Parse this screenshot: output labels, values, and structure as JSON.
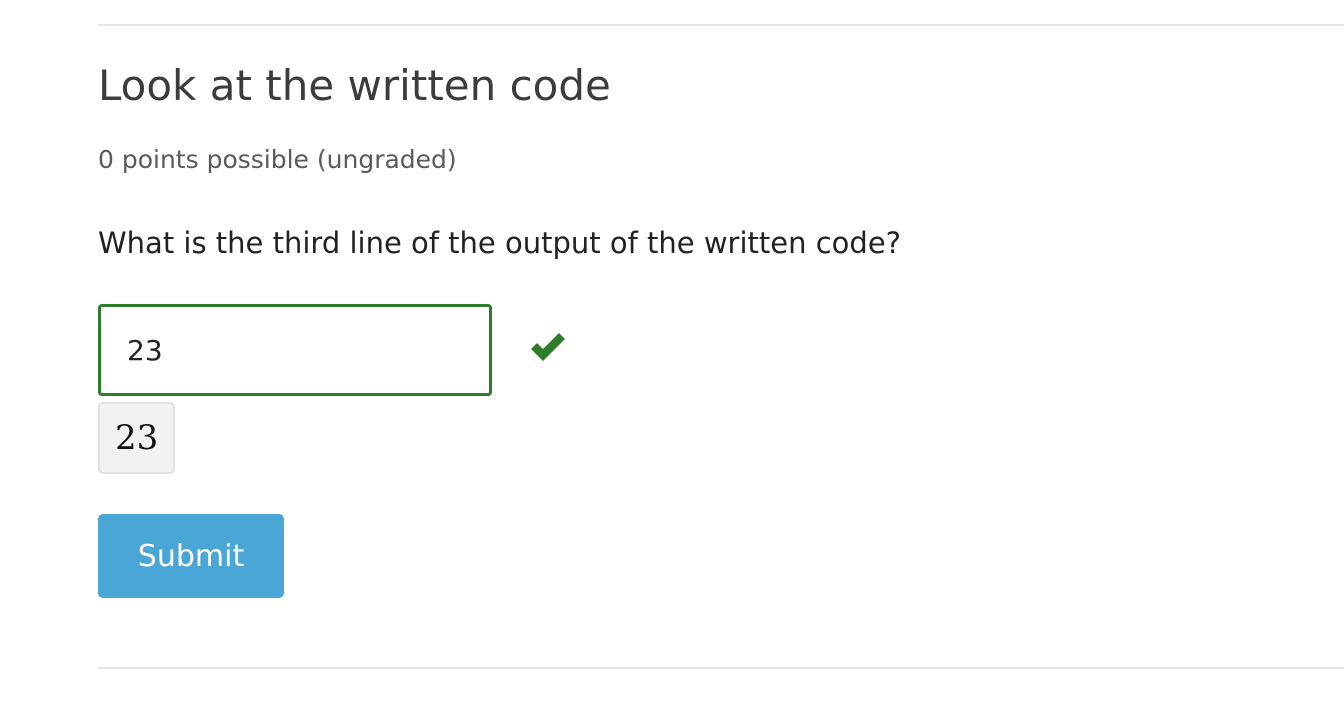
{
  "problem": {
    "title": "Look at the written code",
    "points": "0 points possible (ungraded)",
    "question": "What is the third line of the output of the written code?"
  },
  "answer": {
    "value": "23",
    "preview": "23",
    "status": "correct",
    "status_icon": "check-icon",
    "status_color": "#2e7d2a"
  },
  "actions": {
    "submit_label": "Submit",
    "submit_color": "#4aa7d5"
  }
}
